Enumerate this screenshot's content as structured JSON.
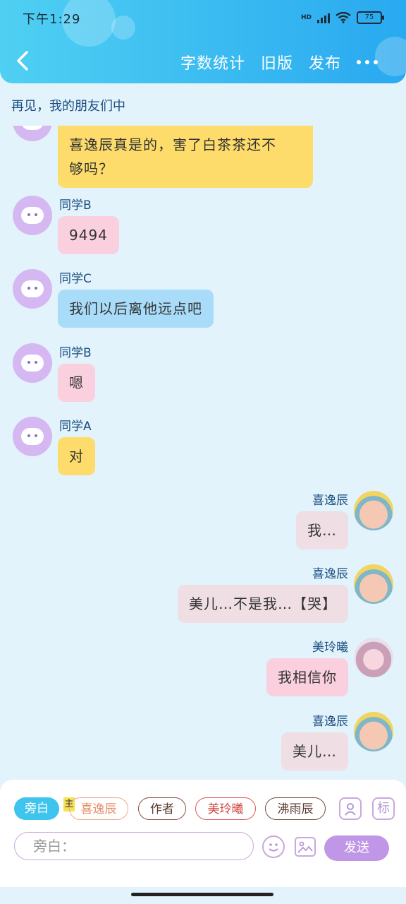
{
  "status_bar": {
    "time": "下午1:29",
    "network": "HD",
    "battery": "75"
  },
  "header": {
    "actions": [
      "字数统计",
      "旧版",
      "发布"
    ],
    "back_icon": "chevron-left-icon",
    "more_icon": "more-dots-icon"
  },
  "chat": {
    "title": "再见，我的朋友们中",
    "messages": [
      {
        "side": "left",
        "sender": "",
        "text": "喜逸辰真是的，害了白茶茶还不",
        "text2": "够吗？",
        "color": "yellow"
      },
      {
        "side": "left",
        "sender": "同学B",
        "text": "9494",
        "color": "pink"
      },
      {
        "side": "left",
        "sender": "同学C",
        "text": "我们以后离他远点吧",
        "color": "blue"
      },
      {
        "side": "left",
        "sender": "同学B",
        "text": "嗯",
        "color": "pink"
      },
      {
        "side": "left",
        "sender": "同学A",
        "text": "对",
        "color": "yellow"
      },
      {
        "side": "right",
        "sender": "喜逸辰",
        "text": "我…",
        "color": "gray"
      },
      {
        "side": "right",
        "sender": "喜逸辰",
        "text": "美儿…不是我…【哭】",
        "color": "gray"
      },
      {
        "side": "right",
        "sender": "美玲曦",
        "text": "我相信你",
        "color": "pink"
      },
      {
        "side": "right",
        "sender": "喜逸辰",
        "text": "美儿…",
        "color": "gray"
      }
    ]
  },
  "composer": {
    "roles": [
      {
        "label": "旁白",
        "active": true
      },
      {
        "label": "喜逸辰",
        "tag": "主"
      },
      {
        "label": "作者"
      },
      {
        "label": "美玲曦"
      },
      {
        "label": "沸雨辰"
      }
    ],
    "input_placeholder": "旁白：",
    "send_label": "发送",
    "tool_icons": [
      "person-card-icon",
      "tag-icon",
      "emoji-icon",
      "image-icon"
    ]
  },
  "colors": {
    "header_start": "#4fd0f2",
    "header_end": "#29a9f0",
    "bubble_yellow": "#fedc6b",
    "bubble_pink": "#fad0de",
    "bubble_blue": "#a9dcf8",
    "bubble_gray": "#efdee3",
    "send_button": "#c097e6"
  }
}
